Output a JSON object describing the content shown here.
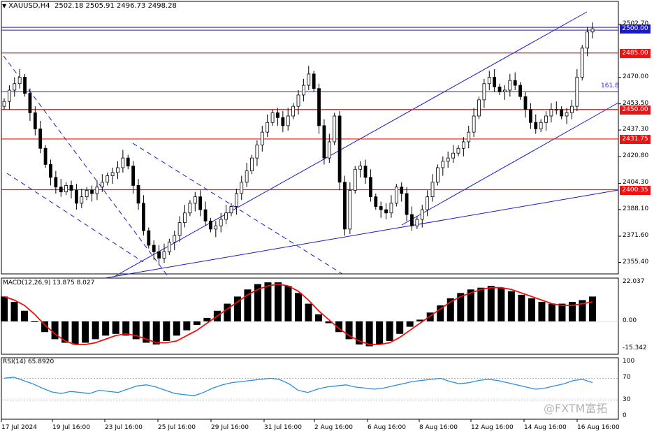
{
  "header": {
    "symbol": "XAUUSD,H4",
    "ohlc": "2502.18 2505.91 2496.73 2498.28"
  },
  "price_axis": [
    "2502.70",
    "2470.00",
    "2453.50",
    "2437.30",
    "2420.80",
    "2404.30",
    "2388.10",
    "2371.60",
    "2355.40"
  ],
  "levels": [
    {
      "label": "2500.00",
      "price": 2500.0,
      "color": "#1a1acc",
      "kind": "blue"
    },
    {
      "label": "2485.00",
      "price": 2485.0,
      "color": "#ee1111",
      "kind": "red"
    },
    {
      "label": "2450.00",
      "price": 2450.0,
      "color": "#ee1111",
      "kind": "red"
    },
    {
      "label": "2431.75",
      "price": 2431.75,
      "color": "#ee1111",
      "kind": "red"
    },
    {
      "label": "2400.35",
      "price": 2400.35,
      "color": "#ee1111",
      "kind": "red"
    }
  ],
  "fib_label": "161.8",
  "fib_price": 2461.0,
  "macd": {
    "label": "MACD(12,26,9) 13.875 8.027",
    "axis": [
      "22.037",
      "0.00",
      "-15.342"
    ]
  },
  "rsi": {
    "label": "RSI(14) 65.8920",
    "axis": [
      "100",
      "70",
      "30",
      "0"
    ]
  },
  "time_axis": [
    "17 Jul 2024",
    "19 Jul 16:00",
    "23 Jul 16:00",
    "25 Jul 16:00",
    "29 Jul 16:00",
    "31 Jul 16:00",
    "2 Aug 16:00",
    "6 Aug 16:00",
    "8 Aug 16:00",
    "12 Aug 16:00",
    "14 Aug 16:00",
    "16 Aug 16:00"
  ],
  "watermark": "@FXTM富拓",
  "colors": {
    "bull": "#ffffff",
    "bear": "#000000",
    "signal": "#ee1111",
    "rsi": "#2a8ee0",
    "trend": "#1a1acc"
  },
  "chart_data": {
    "type": "candlestick",
    "symbol": "XAUUSD",
    "timeframe": "H4",
    "close_path": [
      2455,
      2462,
      2466,
      2470,
      2460,
      2448,
      2438,
      2426,
      2416,
      2408,
      2402,
      2399,
      2403,
      2400,
      2392,
      2396,
      2400,
      2398,
      2402,
      2405,
      2409,
      2411,
      2414,
      2420,
      2415,
      2403,
      2392,
      2375,
      2366,
      2362,
      2358,
      2362,
      2368,
      2372,
      2380,
      2386,
      2392,
      2396,
      2388,
      2381,
      2376,
      2378,
      2382,
      2386,
      2390,
      2398,
      2405,
      2412,
      2420,
      2428,
      2436,
      2442,
      2448,
      2445,
      2440,
      2446,
      2452,
      2459,
      2465,
      2472,
      2463,
      2440,
      2420,
      2430,
      2446,
      2405,
      2376,
      2400,
      2413,
      2415,
      2408,
      2396,
      2390,
      2388,
      2386,
      2392,
      2402,
      2398,
      2385,
      2378,
      2382,
      2388,
      2396,
      2405,
      2414,
      2418,
      2420,
      2423,
      2426,
      2430,
      2436,
      2446,
      2456,
      2466,
      2470,
      2464,
      2461,
      2462,
      2468,
      2465,
      2458,
      2450,
      2442,
      2438,
      2442,
      2446,
      2450,
      2450,
      2446,
      2448,
      2452,
      2470,
      2488,
      2498,
      2500
    ],
    "series": [
      {
        "name": "MACD(12,26,9)",
        "values": [
          14,
          11,
          6,
          0,
          -6,
          -10,
          -12,
          -13,
          -12,
          -10,
          -8,
          -7,
          -8,
          -10,
          -12,
          -13,
          -11,
          -8,
          -5,
          -2,
          2,
          6,
          10,
          14,
          18,
          21,
          22,
          22,
          20,
          16,
          10,
          4,
          -1,
          -6,
          -10,
          -13,
          -14,
          -13,
          -11,
          -7,
          -3,
          1,
          5,
          9,
          13,
          16,
          18,
          19,
          20,
          19,
          17,
          15,
          13,
          11,
          10,
          10,
          11,
          12,
          14
        ],
        "signal_values": [
          14,
          12,
          9,
          4,
          -2,
          -7,
          -11,
          -13,
          -13,
          -12,
          -10,
          -8,
          -7,
          -8,
          -10,
          -12,
          -12,
          -11,
          -8,
          -5,
          -1,
          3,
          7,
          11,
          15,
          18,
          20,
          21,
          20,
          17,
          12,
          6,
          1,
          -4,
          -8,
          -11,
          -13,
          -13,
          -12,
          -9,
          -5,
          -1,
          3,
          7,
          11,
          14,
          16,
          18,
          19,
          19,
          18,
          16,
          14,
          12,
          10,
          9,
          9,
          10,
          11
        ]
      },
      {
        "name": "RSI(14)",
        "values": [
          70,
          72,
          66,
          60,
          52,
          45,
          42,
          46,
          44,
          42,
          48,
          46,
          44,
          50,
          56,
          58,
          54,
          48,
          42,
          40,
          38,
          44,
          52,
          58,
          62,
          64,
          66,
          68,
          70,
          68,
          60,
          48,
          44,
          50,
          54,
          56,
          58,
          54,
          52,
          50,
          52,
          56,
          60,
          64,
          66,
          68,
          70,
          64,
          60,
          62,
          66,
          68,
          66,
          62,
          58,
          54,
          50,
          52,
          56,
          60,
          66,
          68,
          62
        ]
      }
    ],
    "y_range": [
      2350,
      2510
    ],
    "macd_range": [
      -15.342,
      22.037
    ],
    "rsi_range": [
      0,
      100
    ],
    "horizontal_levels": [
      2500.0,
      2485.0,
      2450.0,
      2431.75,
      2400.35
    ]
  }
}
